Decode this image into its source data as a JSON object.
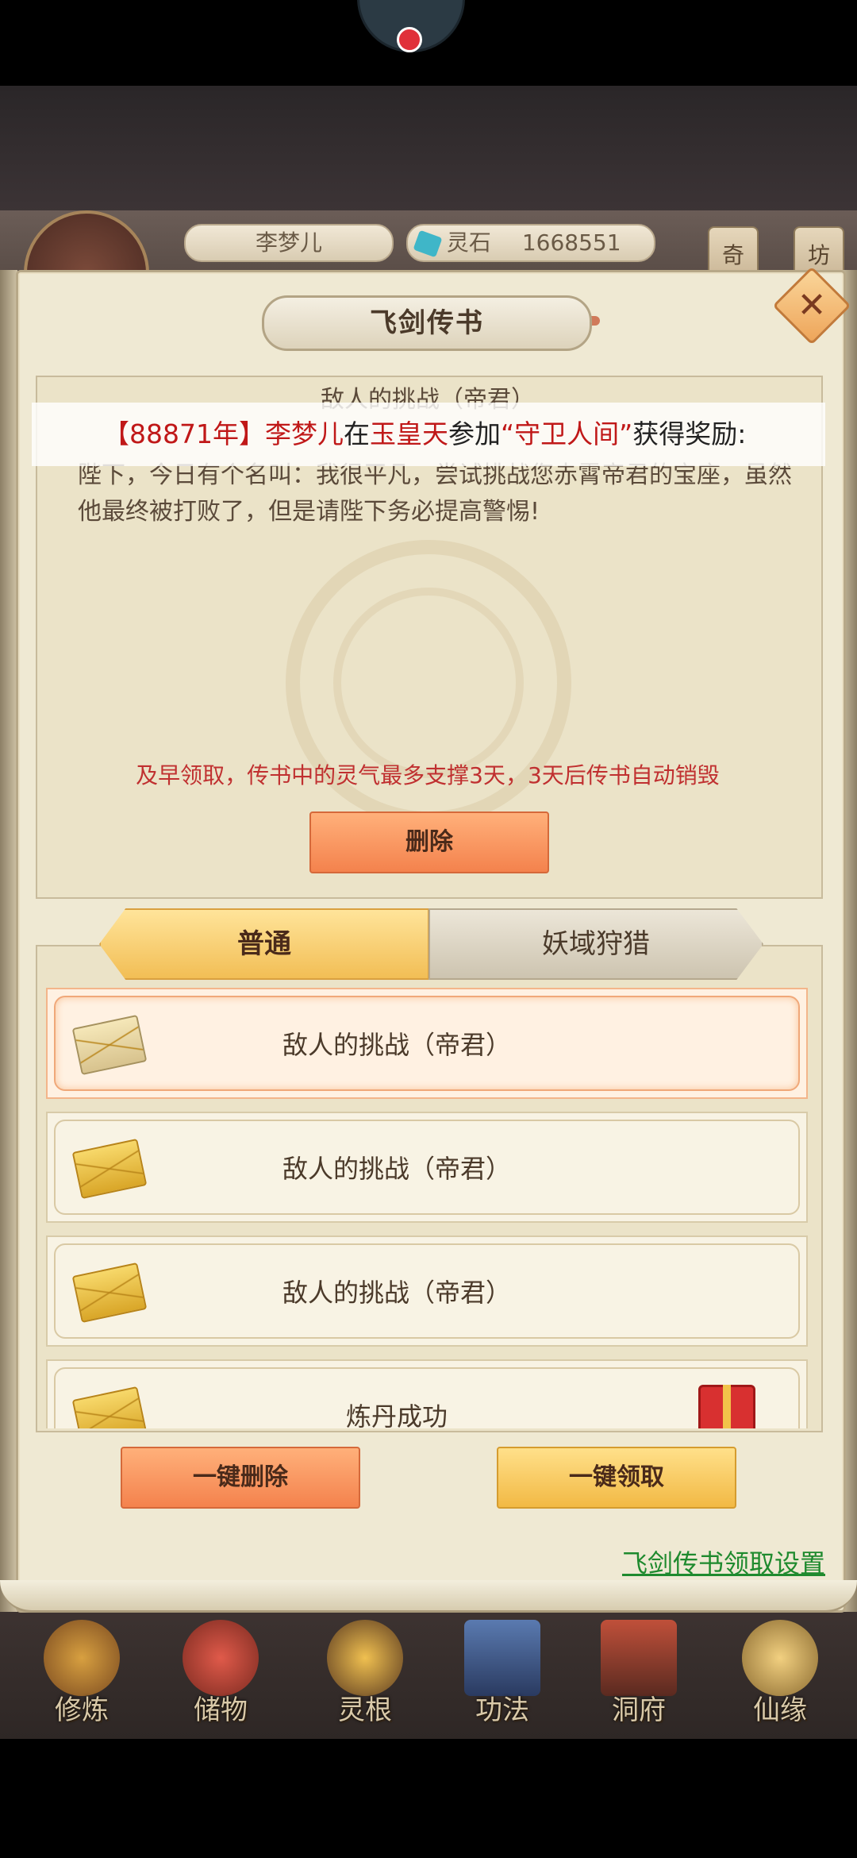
{
  "top_bar": {
    "record_icon": "record-dot-icon"
  },
  "status": {
    "player_name": "李梦儿",
    "currency_label": "灵石",
    "currency_value": "1668551",
    "side_buttons": [
      "奇",
      "坊"
    ]
  },
  "panel": {
    "title": "飞剑传书",
    "close_icon": "close-icon"
  },
  "letter": {
    "title": "敌人的挑战（帝君）",
    "body": "陛下，今日有个名叫：我很平凡，尝试挑战您赤霄帝君的宝座，虽然他最终被打败了，但是请陛下务必提高警惕!",
    "warning": "及早领取，传书中的灵气最多支撑3天，3天后传书自动销毁",
    "delete_label": "删除"
  },
  "broadcast": {
    "year": "【88871年】",
    "name": "李梦儿",
    "connector": "在",
    "place": "玉皇天",
    "action": "参加",
    "event": "“守卫人间”",
    "suffix": "获得奖励:"
  },
  "tabs": [
    {
      "label": "普通",
      "active": true
    },
    {
      "label": "妖域狩猎",
      "active": false
    }
  ],
  "mails": [
    {
      "label": "敌人的挑战（帝君）",
      "state": "opened",
      "selected": true
    },
    {
      "label": "敌人的挑战（帝君）",
      "state": "unread",
      "selected": false
    },
    {
      "label": "敌人的挑战（帝君）",
      "state": "unread",
      "selected": false
    },
    {
      "label": "炼丹成功",
      "state": "unread",
      "selected": false,
      "has_gift": true
    }
  ],
  "actions": {
    "delete_all": "一键删除",
    "claim_all": "一键领取",
    "settings_link": "飞剑传书领取设置"
  },
  "bottom_nav": [
    "修炼",
    "储物",
    "灵根",
    "功法",
    "洞府",
    "仙缘"
  ],
  "colors": {
    "accent_red": "#c01818",
    "warning_red": "#c03030",
    "link_green": "#1f8a2e",
    "orange_button": "#f4824d",
    "gold_button": "#f2b944"
  }
}
